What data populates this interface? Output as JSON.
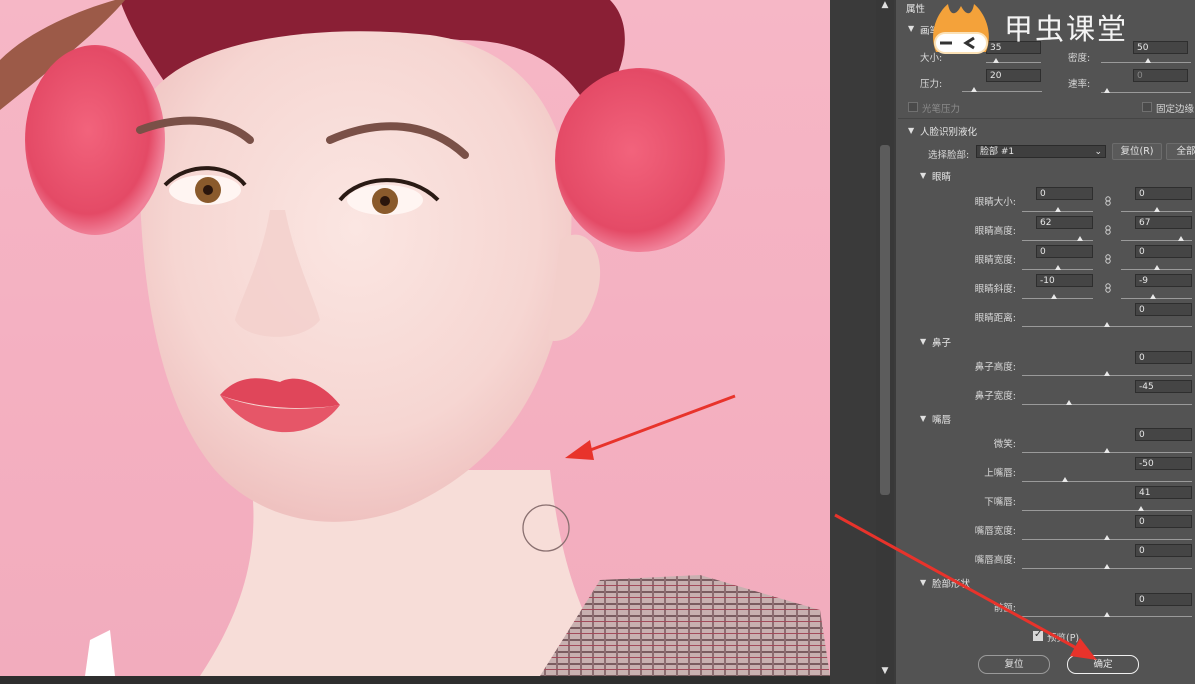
{
  "panel": {
    "title": "属性",
    "brush": {
      "header": "画笔",
      "size_label": "大小:",
      "size_value": "35",
      "density_label": "密度:",
      "density_value": "50",
      "pressure_label": "压力:",
      "pressure_value": "20",
      "rate_label": "速率:",
      "rate_value": "0",
      "stylus_label": "光笔压力",
      "pin_edges_label": "固定边缘"
    },
    "face_aware": {
      "header": "人脸识别液化",
      "select_face_label": "选择脸部:",
      "select_face_value": "脸部 #1",
      "reset_button": "复位(R)",
      "all_button": "全部"
    },
    "eyes": {
      "header": "眼睛",
      "rows": [
        {
          "label": "眼睛大小:",
          "left": "0",
          "right": "0"
        },
        {
          "label": "眼睛高度:",
          "left": "62",
          "right": "67"
        },
        {
          "label": "眼睛宽度:",
          "left": "0",
          "right": "0"
        },
        {
          "label": "眼睛斜度:",
          "left": "-10",
          "right": "-9"
        }
      ],
      "distance_label": "眼睛距离:",
      "distance_value": "0"
    },
    "nose": {
      "header": "鼻子",
      "rows": [
        {
          "label": "鼻子高度:",
          "value": "0"
        },
        {
          "label": "鼻子宽度:",
          "value": "-45"
        }
      ]
    },
    "mouth": {
      "header": "嘴唇",
      "rows": [
        {
          "label": "微笑:",
          "value": "0"
        },
        {
          "label": "上嘴唇:",
          "value": "-50"
        },
        {
          "label": "下嘴唇:",
          "value": "41"
        },
        {
          "label": "嘴唇宽度:",
          "value": "0"
        },
        {
          "label": "嘴唇高度:",
          "value": "0"
        }
      ]
    },
    "face_shape": {
      "header": "脸部形状",
      "row_label": "前额:",
      "row_value": "0"
    },
    "preview_label": "预览(P)",
    "reset_button": "复位",
    "ok_button": "确定"
  },
  "watermark": {
    "text": "甲虫课堂"
  },
  "colors": {
    "panel_bg": "#535353",
    "canvas_bg": "#f4b0c1",
    "arrow": "#e8332b"
  }
}
